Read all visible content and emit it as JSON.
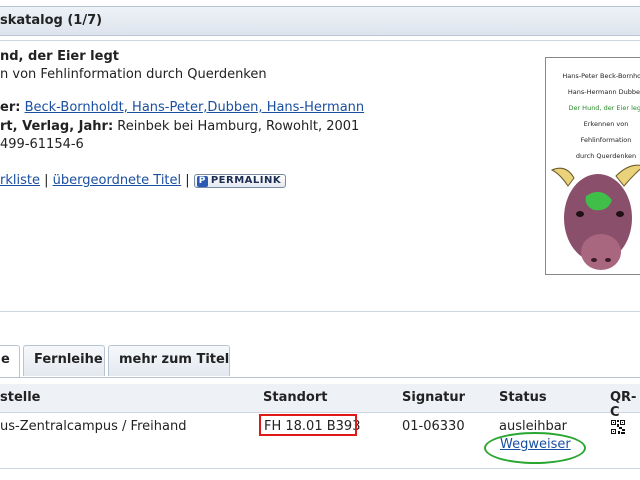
{
  "header": {
    "title": "skatalog (1/7)"
  },
  "record": {
    "title_line": "nd, der Eier legt",
    "subtitle_line": "n von Fehlinformation durch Querdenken",
    "authors_label": "er:",
    "authors": "Beck-Bornholdt, Hans-Peter,Dubben, Hans-Hermann",
    "publication_label": "rt, Verlag, Jahr:",
    "publication_value": "Reinbek bei Hamburg, Rowohlt, 2001",
    "isbn": "499-61154-6",
    "links": {
      "merkliste": "rkliste",
      "separator": "|",
      "parent_title": "übergeordnete Titel",
      "permalink": "PERMALINK",
      "permalink_icon": "P"
    },
    "cover": {
      "line1": "Hans-Peter Beck-Bornholdt",
      "line2": "Hans-Hermann Dubben",
      "line3": "Der Hund, der Eier legt",
      "line4": "Erkennen von",
      "line5": "Fehlinformation",
      "line6": "durch Querdenken"
    }
  },
  "tabs": [
    {
      "label": "e",
      "active": true
    },
    {
      "label": "Fernleihe",
      "active": false
    },
    {
      "label": "mehr zum Titel",
      "active": false
    }
  ],
  "holdings": {
    "headers": {
      "location_area": "stelle",
      "standort": "Standort",
      "signatur": "Signatur",
      "status": "Status",
      "qr": "QR-C"
    },
    "row": {
      "location_area": "us-Zentralcampus / Freihand",
      "standort": "FH 18.01 B393",
      "signatur": "01-06330",
      "status": "ausleihbar",
      "wegweiser": "Wegweiser"
    }
  },
  "colors": {
    "highlight_red": "#e01818",
    "highlight_green": "#2aa632",
    "link": "#1a4fa0"
  }
}
